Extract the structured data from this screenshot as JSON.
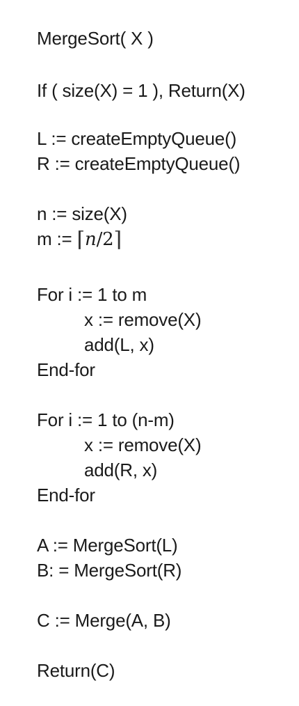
{
  "document": {
    "header": "MergeSort( X )",
    "base_case": "If ( size(X) = 1 ), Return(X)",
    "init_l": "L := createEmptyQueue()",
    "init_r": "R := createEmptyQueue()",
    "n_assign": "n := size(X)",
    "m_assign": {
      "prefix": "m := ",
      "ceil_open": "⌈",
      "expr_n": "n",
      "expr_slash": "/",
      "expr_2": "2",
      "ceil_close": "⌉"
    },
    "loop1": {
      "head": "For i := 1 to m",
      "body_1": "x := remove(X)",
      "body_2": "add(L, x)",
      "end": "End-for"
    },
    "loop2": {
      "head": "For i := 1 to (n-m)",
      "body_1": "x := remove(X)",
      "body_2": "add(R, x)",
      "end": "End-for"
    },
    "recurse_a": "A := MergeSort(L)",
    "recurse_b": "B: = MergeSort(R)",
    "merge": "C := Merge(A, B)",
    "return": "Return(C)"
  }
}
